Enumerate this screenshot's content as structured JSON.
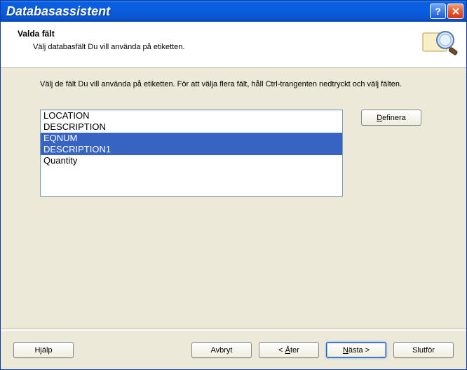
{
  "window": {
    "title": "Databasassistent"
  },
  "header": {
    "title": "Valda fält",
    "subtitle": "Välj databasfält Du vill använda på etiketten."
  },
  "instruction": "Välj de fält Du vill använda på etiketten. För att välja flera fält, håll Ctrl-trangenten nedtryckt och välj fälten.",
  "fields": [
    {
      "label": "LOCATION",
      "selected": false
    },
    {
      "label": "DESCRIPTION",
      "selected": false
    },
    {
      "label": "EQNUM",
      "selected": true
    },
    {
      "label": "DESCRIPTION1",
      "selected": true
    },
    {
      "label": "Quantity",
      "selected": false
    }
  ],
  "buttons": {
    "define": "Definera",
    "help": "Hjälp",
    "cancel": "Avbryt",
    "back_prefix": "< ",
    "back_rest": "ter",
    "back_mn": "Å",
    "next_prefix": "",
    "next_rest": "ästa >",
    "next_mn": "N",
    "finish": "Slutför"
  }
}
